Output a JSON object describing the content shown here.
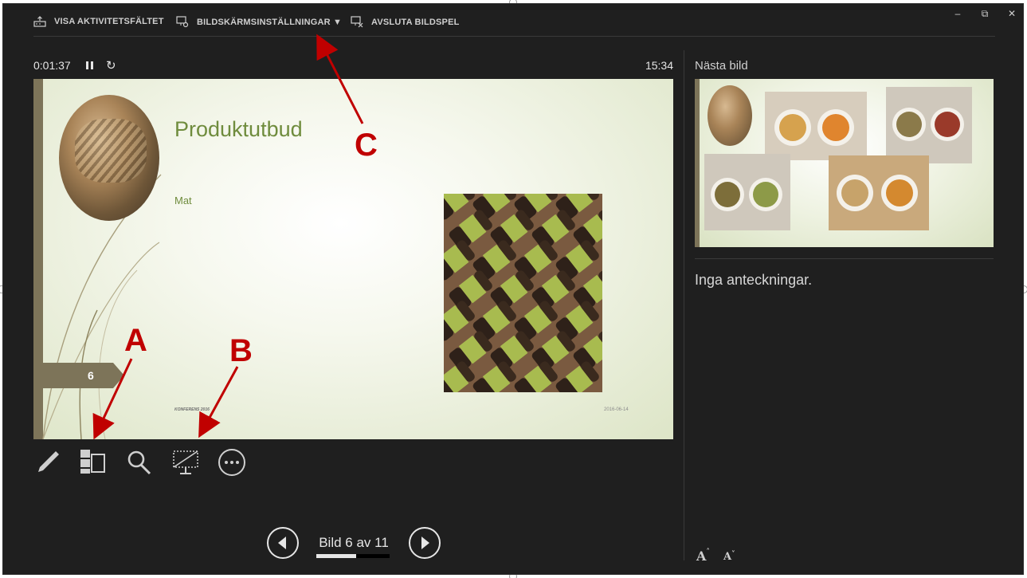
{
  "toolbar": {
    "show_taskbar": "VISA AKTIVITETSFÄLTET",
    "display_settings": "BILDSKÄRMSINSTÄLLNINGAR ▼",
    "end_show": "AVSLUTA BILDSPEL"
  },
  "window_controls": {
    "minimize": "–",
    "restore": "⧉",
    "close": "✕"
  },
  "timer": {
    "elapsed": "0:01:37",
    "clock": "15:34"
  },
  "current_slide": {
    "title": "Produktutbud",
    "subtitle": "Mat",
    "number": "6",
    "footer": "KONFERENS 2016",
    "date": "2016-06-14"
  },
  "navigation": {
    "label": "Bild 6 av 11",
    "progress": 0.545
  },
  "right_panel": {
    "next_label": "Nästa bild",
    "notes": "Inga anteckningar."
  },
  "notes_font": {
    "increase": "A",
    "decrease": "A"
  },
  "annotations": {
    "a": "A",
    "b": "B",
    "c": "C"
  },
  "colors": {
    "background": "#1f1f1f",
    "accent_green": "#6f8c3d",
    "annotation_red": "#c00000"
  },
  "icons": {
    "show_taskbar": "taskbar-icon",
    "display_settings": "monitor-gear-icon",
    "end_show": "monitor-x-icon",
    "pause": "pause-icon",
    "restart": "restart-icon",
    "pen": "pen-icon",
    "see_all": "slides-grid-icon",
    "zoom": "magnifier-icon",
    "black_screen": "monitor-dashed-icon",
    "more": "more-options-icon",
    "prev": "arrow-left-circle-icon",
    "next": "arrow-right-circle-icon"
  }
}
